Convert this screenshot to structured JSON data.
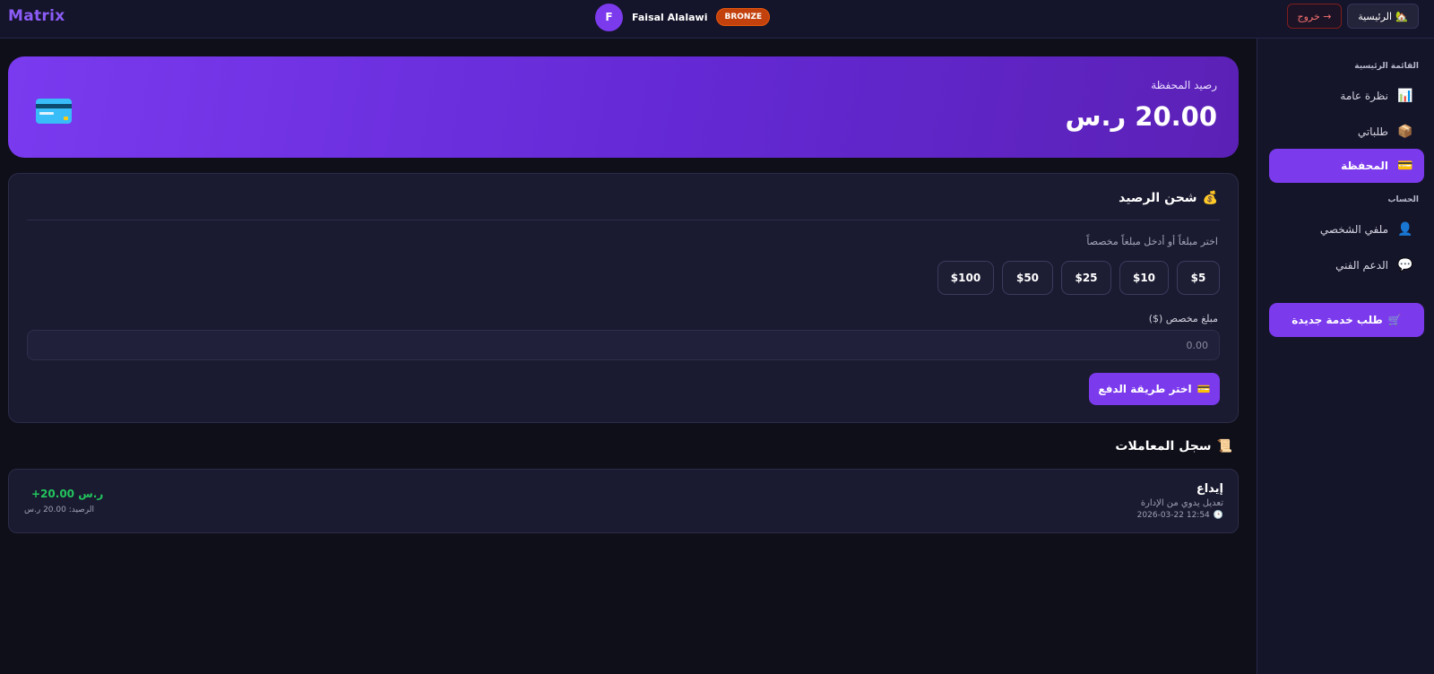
{
  "header": {
    "logo": "Matrix",
    "user_initial": "F",
    "user_name": "Faisal Alalawi",
    "tier": "BRONZE",
    "logout_label": "خروج →",
    "home_label": "الرئيسية",
    "home_icon": "house-icon"
  },
  "sidebar": {
    "section_main": "القائمة الرئيسية",
    "section_account": "الحساب",
    "items": [
      {
        "label": "نظرة عامة",
        "icon": "📊"
      },
      {
        "label": "طلباتي",
        "icon": "📦"
      },
      {
        "label": "المحفظة",
        "icon": "💳",
        "active": true
      },
      {
        "label": "ملفي الشخصي",
        "icon": "👤"
      },
      {
        "label": "الدعم الفني",
        "icon": "💬"
      }
    ],
    "new_service_label": "طلب خدمة جديدة",
    "new_service_icon": "🛒"
  },
  "wallet": {
    "label": "رصيد المحفظة",
    "balance": "20.00 ر.س"
  },
  "topup": {
    "title": "شحن الرصيد",
    "title_icon": "💰",
    "hint": "اختر مبلغاً أو أدخل مبلغاً مخصصاً",
    "amounts": [
      "$5",
      "$10",
      "$25",
      "$50",
      "$100"
    ],
    "custom_label": "مبلغ مخصص ($)",
    "custom_placeholder": "0.00",
    "pay_label": "اختر طريقة الدفع",
    "pay_icon": "💳"
  },
  "transactions": {
    "title": "سجل المعاملات",
    "title_icon": "📜",
    "rows": [
      {
        "type": "إيداع",
        "description": "تعديل يدوي من الإدارة",
        "date": "2026-03-22 12:54",
        "amount": "+20.00 ر.س",
        "balance": "الرصيد: 20.00 ر.س"
      }
    ]
  },
  "colors": {
    "accent": "#7c3aed",
    "background": "#0f0f1a",
    "positive": "#22c55e",
    "danger": "#f87171",
    "tier": "#c2410c"
  }
}
